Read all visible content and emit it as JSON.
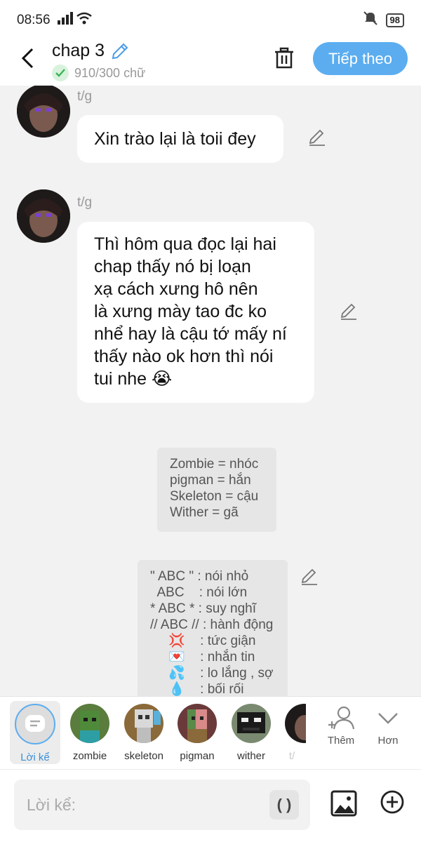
{
  "status": {
    "time": "08:56",
    "battery": "98"
  },
  "header": {
    "title": "chap 3",
    "word_count": "910/300 chữ",
    "next_label": "Tiếp theo"
  },
  "messages": [
    {
      "speaker": "t/g",
      "text": "Xin trào lại là toii đey"
    },
    {
      "speaker": "t/g",
      "lines": [
        "Thì hôm qua đọc lại hai",
        "chap thấy nó bị loạn",
        "xạ cách xưng hô nên",
        "là xưng mày tao đc ko",
        "nhể hay là cậu tớ mấy ní",
        "thấy nào ok hơn thì nói",
        "tui nhe 😭"
      ]
    }
  ],
  "note1": {
    "lines": [
      "Zombie = nhóc",
      "pigman = hắn",
      "Skeleton = cậu",
      "Wither = gã"
    ]
  },
  "note2": {
    "lines": [
      "\" ABC \" : nói nhỏ",
      "  ABC    : nói lớn",
      "* ABC * : suy nghĩ",
      "// ABC // : hành động",
      "     💢    : tức giận",
      "     💌    : nhắn tin",
      "     💦    : lo lắng , sợ",
      "     💧    : bối rối"
    ]
  },
  "characters": [
    {
      "label": "Lời kể",
      "selected": true
    },
    {
      "label": "zombie"
    },
    {
      "label": "skeleton"
    },
    {
      "label": "pigman"
    },
    {
      "label": "wither"
    },
    {
      "label": "t/"
    }
  ],
  "aux": {
    "more_label": "Thêm",
    "expand_label": "Hơn"
  },
  "input": {
    "placeholder": "Lời kể:",
    "paren": "( )"
  },
  "colors": {
    "accent": "#5badf0",
    "bg": "#f2f2f2"
  }
}
